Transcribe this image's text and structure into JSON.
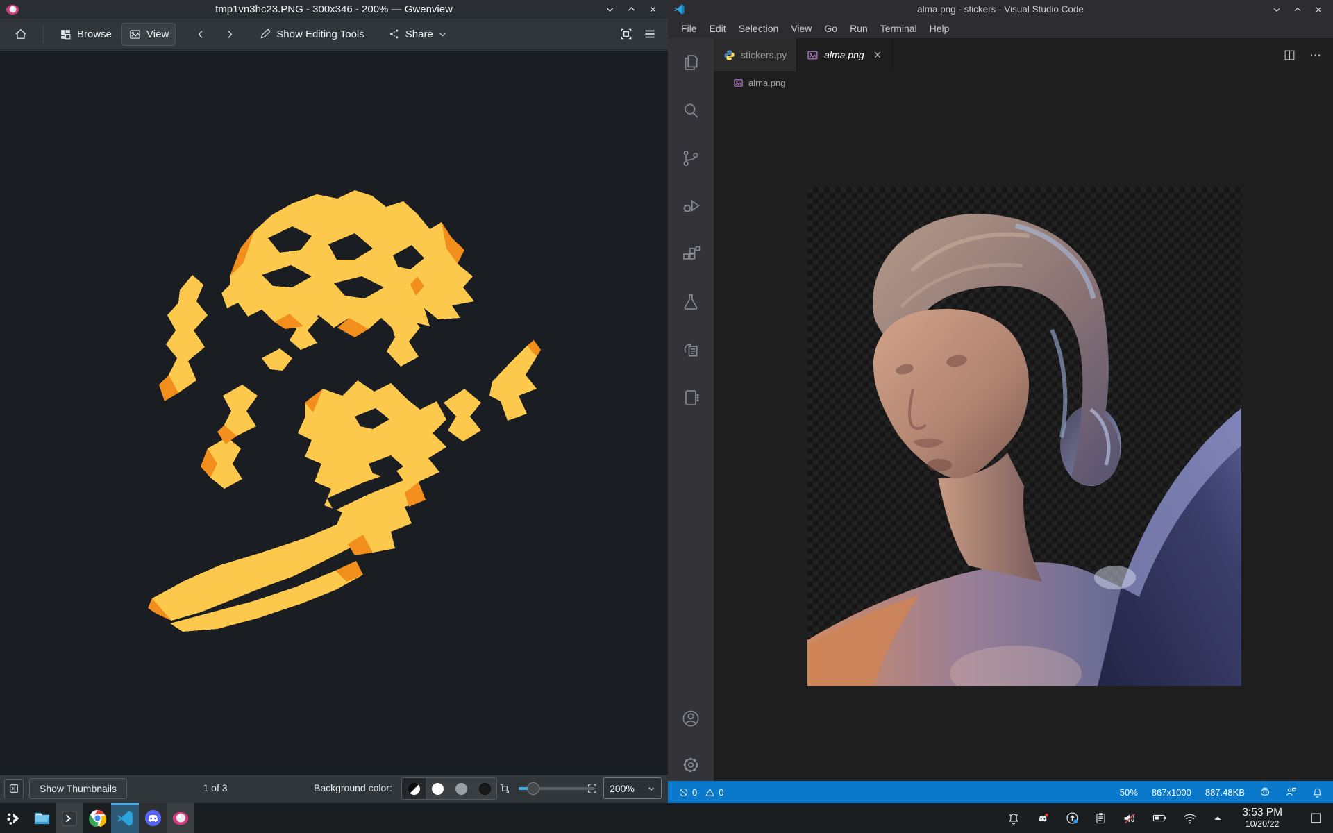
{
  "gwenview": {
    "window_title": "tmp1vn3hc23.PNG - 300x346 - 200% — Gwenview",
    "toolbar": {
      "browse_label": "Browse",
      "view_label": "View",
      "editing_tools_label": "Show Editing Tools",
      "share_label": "Share"
    },
    "statusbar": {
      "show_thumbnails_label": "Show Thumbnails",
      "position_indicator": "1 of 3",
      "background_color_label": "Background color:",
      "zoom_value": "200%"
    }
  },
  "vscode": {
    "window_title": "alma.png - stickers - Visual Studio Code",
    "menus": [
      "File",
      "Edit",
      "Selection",
      "View",
      "Go",
      "Run",
      "Terminal",
      "Help"
    ],
    "tabs": {
      "tab1_label": "stickers.py",
      "tab2_label": "alma.png"
    },
    "breadcrumb_file": "alma.png",
    "statusbar": {
      "errors": "0",
      "warnings": "0",
      "zoom": "50%",
      "dimensions": "867x1000",
      "filesize": "887.48KB"
    }
  },
  "taskbar": {
    "clock_time": "3:53 PM",
    "clock_date": "10/20/22"
  },
  "colors": {
    "accent_blue": "#0a79cc",
    "kde_panel": "#31363b",
    "statue_yellow": "#fcc94d",
    "statue_orange": "#f28e1c"
  }
}
